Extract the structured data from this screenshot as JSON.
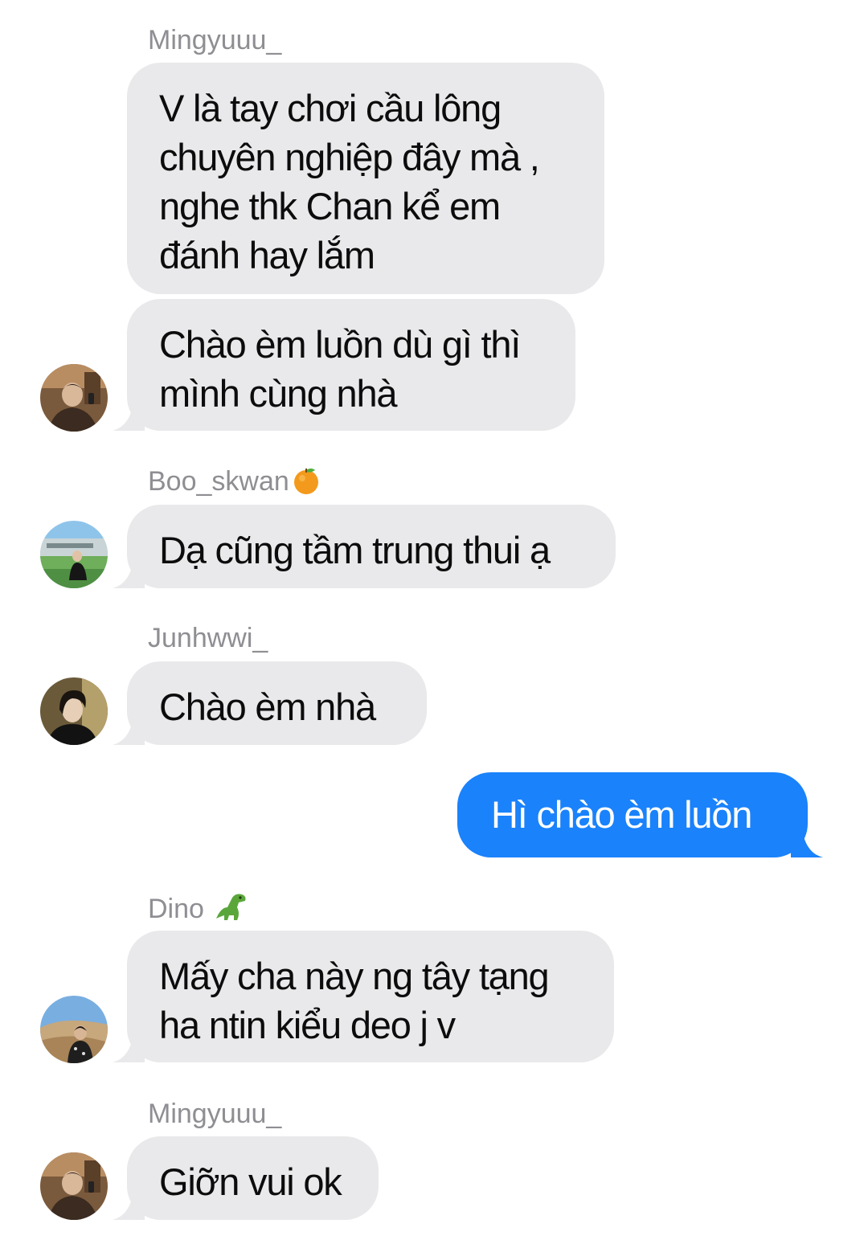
{
  "colors": {
    "incoming_bubble": "#e9e9eb",
    "outgoing_bubble": "#1a82fb",
    "sender_name": "#8e8e93"
  },
  "messages": [
    {
      "sender": "Mingyuuu_",
      "lines": [
        "V là tay chơi cầu lông",
        "chuyên nghiệp đây mà ,",
        "nghe thk Chan kể em",
        "đánh hay lắm"
      ]
    },
    {
      "lines": [
        "Chào èm luồn dù gì thì",
        "mình cùng nhà"
      ],
      "avatar": "avatar-mingyu"
    },
    {
      "sender": "Boo_skwan",
      "sender_emoji": "tangerine-emoji",
      "lines": [
        "Dạ cũng tầm trung thui ạ"
      ],
      "avatar": "avatar-boo"
    },
    {
      "sender": "Junhwwi_",
      "lines": [
        "Chào èm nhà"
      ],
      "avatar": "avatar-junhwi"
    },
    {
      "outgoing": true,
      "lines": [
        "Hì chào èm luồn"
      ]
    },
    {
      "sender": "Dino",
      "sender_emoji": "t-rex-emoji",
      "lines": [
        "Mấy cha này ng tây tạng",
        "ha ntin kiểu deo j v"
      ],
      "avatar": "avatar-dino"
    },
    {
      "sender": "Mingyuuu_",
      "lines": [
        "Giỡn vui ok"
      ],
      "avatar": "avatar-mingyu"
    }
  ]
}
